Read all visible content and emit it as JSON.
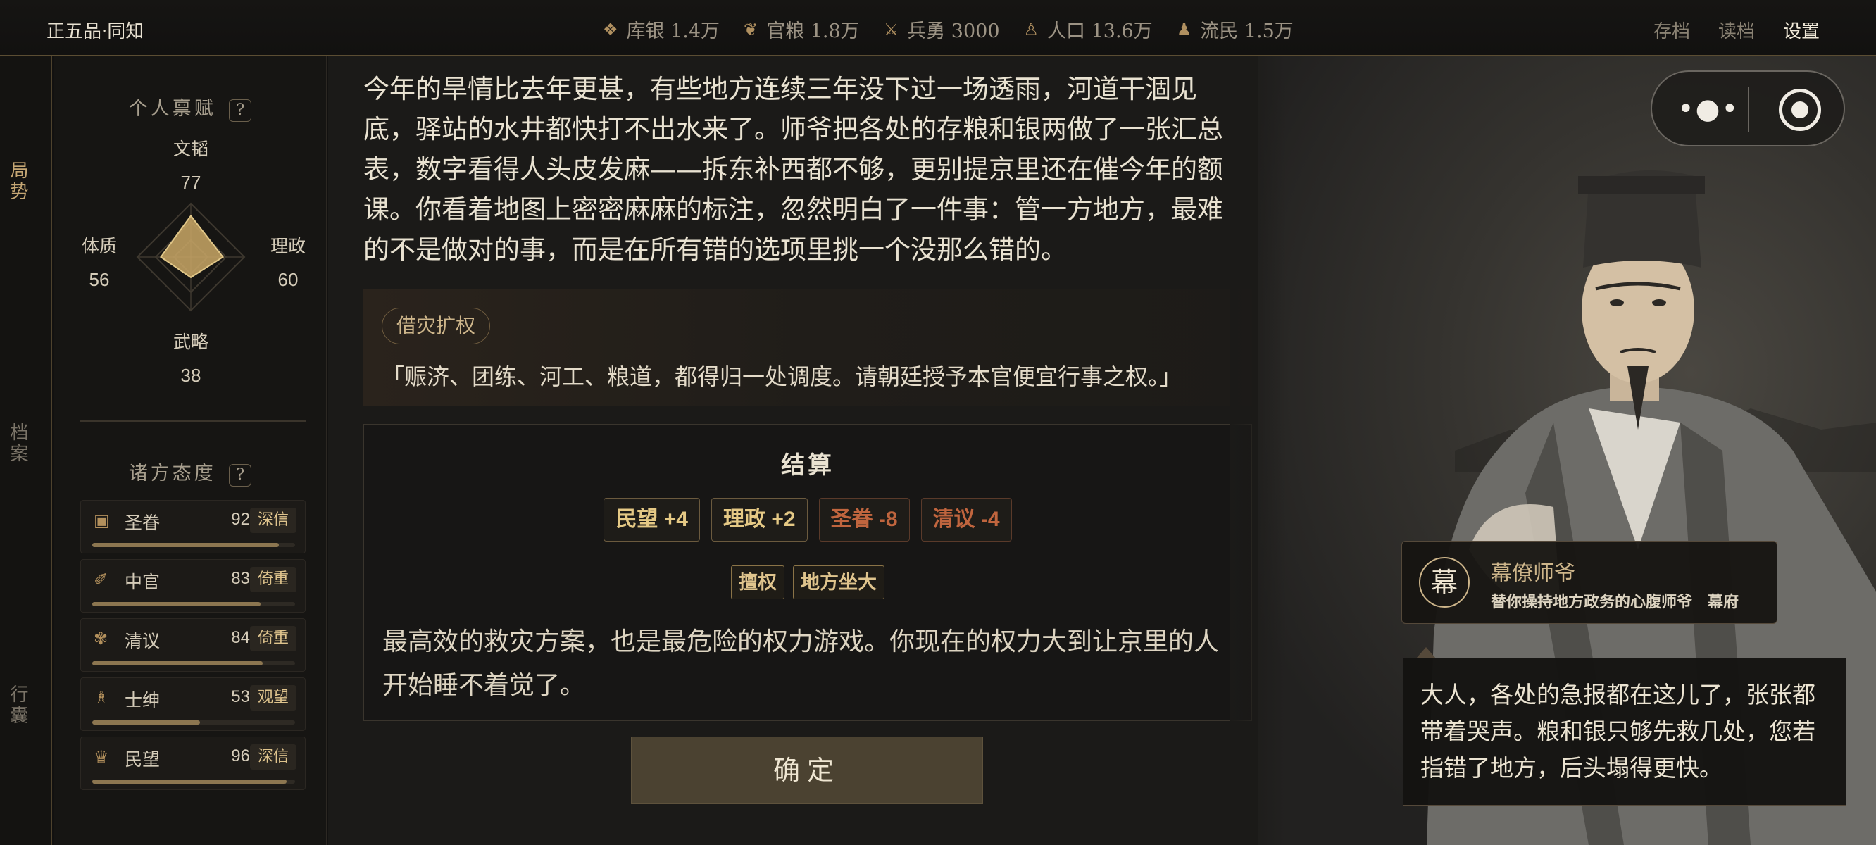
{
  "header": {
    "rank": "正五品·同知",
    "resources": [
      {
        "icon": "silver-icon",
        "label": "库银 1.4万"
      },
      {
        "icon": "grain-icon",
        "label": "官粮 1.8万"
      },
      {
        "icon": "soldier-icon",
        "label": "兵勇 3000"
      },
      {
        "icon": "population-icon",
        "label": "人口 13.6万"
      },
      {
        "icon": "refugee-icon",
        "label": "流民 1.5万"
      }
    ],
    "menu": [
      "存档",
      "读档",
      "设置"
    ]
  },
  "rail": {
    "tabs": [
      "局势",
      "档案",
      "行囊"
    ]
  },
  "stats": {
    "talent_title": "个人禀赋",
    "help": "?",
    "attributes": [
      {
        "name": "文韬",
        "value": 77
      },
      {
        "name": "理政",
        "value": 60
      },
      {
        "name": "武略",
        "value": 38
      },
      {
        "name": "体质",
        "value": 56
      }
    ],
    "attitude_title": "诸方态度",
    "factions": [
      {
        "icon": "imperial-favor-icon",
        "name": "圣眷",
        "value": 92,
        "badge": "深信",
        "level": 0.92
      },
      {
        "icon": "eunuch-icon",
        "name": "中官",
        "value": 83,
        "badge": "倚重",
        "level": 0.83
      },
      {
        "icon": "scholar-icon",
        "name": "清议",
        "value": 84,
        "badge": "倚重",
        "level": 0.84
      },
      {
        "icon": "gentry-icon",
        "name": "士绅",
        "value": 53,
        "badge": "观望",
        "level": 0.53
      },
      {
        "icon": "people-icon",
        "name": "民望",
        "value": 96,
        "badge": "深信",
        "level": 0.96
      }
    ]
  },
  "main": {
    "narrative": "今年的旱情比去年更甚，有些地方连续三年没下过一场透雨，河道干涸见底，驿站的水井都快打不出水来了。师爷把各处的存粮和银两做了一张汇总表，数字看得人头皮发麻——拆东补西都不够，更别提京里还在催今年的额课。你看着地图上密密麻麻的标注，忽然明白了一件事：管一方地方，最难的不是做对的事，而是在所有错的选项里挑一个没那么错的。",
    "choice": {
      "tag": "借灾扩权",
      "quote": "「赈济、团练、河工、粮道，都得归一处调度。请朝廷授予本官便宜行事之权。」"
    },
    "result": {
      "title": "结算",
      "effects": [
        {
          "label": "民望 +4",
          "type": "pos"
        },
        {
          "label": "理政 +2",
          "type": "pos"
        },
        {
          "label": "圣眷 -8",
          "type": "neg"
        },
        {
          "label": "清议 -4",
          "type": "neg"
        }
      ],
      "tags": [
        "擅权",
        "地方坐大"
      ],
      "text": "最高效的救灾方案，也是最危险的权力游戏。你现在的权力大到让京里的人开始睡不着觉了。"
    },
    "confirm": "确定"
  },
  "npc": {
    "seal": "幕",
    "name": "幕僚师爷",
    "desc": "替你操持地方政务的心腹师爷　幕府",
    "dialogue": "大人，各处的急报都在这儿了，张张都带着哭声。粮和银只够先救几处，您若指错了地方，后头塌得更快。"
  },
  "colors": {
    "accent": "#cdb58a",
    "positive": "#e5c985",
    "negative": "#c0653e",
    "panel": "#161513"
  }
}
